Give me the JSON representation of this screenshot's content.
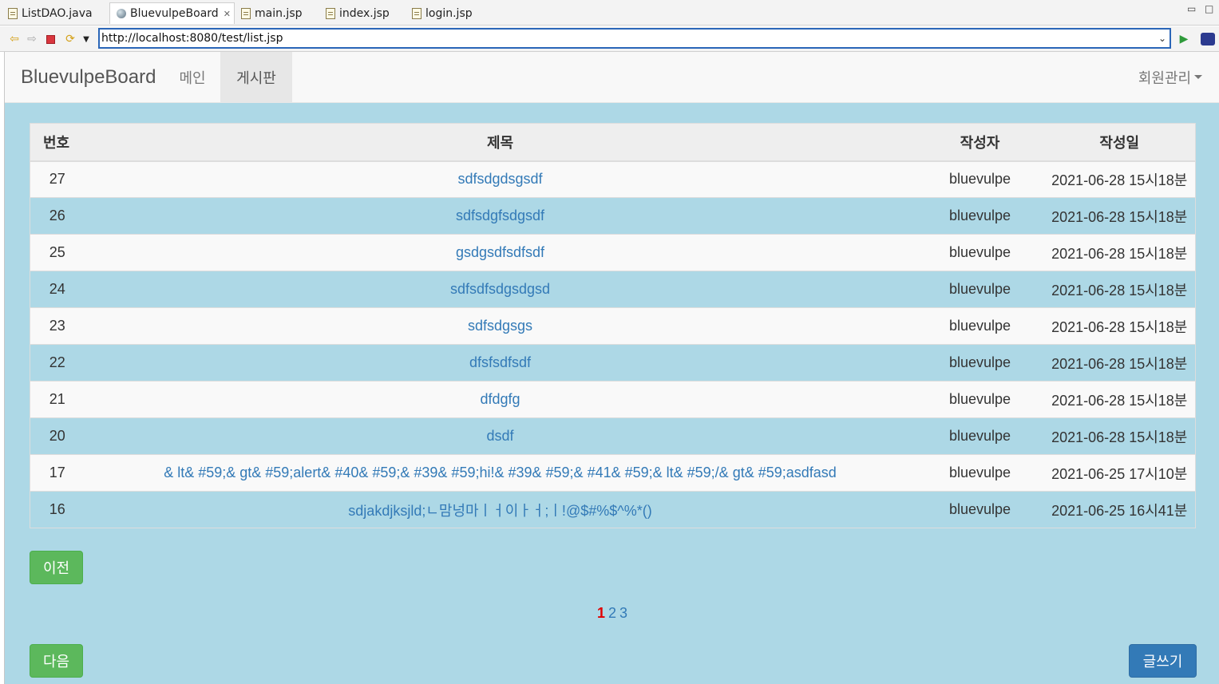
{
  "editor_tabs": [
    {
      "label": "ListDAO.java",
      "icon": "java-file-icon",
      "active": false
    },
    {
      "label": "BluevulpeBoard",
      "icon": "globe-icon",
      "active": true
    },
    {
      "label": "main.jsp",
      "icon": "jsp-file-icon",
      "active": false
    },
    {
      "label": "index.jsp",
      "icon": "jsp-file-icon",
      "active": false
    },
    {
      "label": "login.jsp",
      "icon": "jsp-file-icon",
      "active": false
    }
  ],
  "toolbar": {
    "url": "http://localhost:8080/test/list.jsp",
    "icons": [
      "back-icon",
      "forward-icon",
      "stop-icon",
      "refresh-icon",
      "menu-dropdown-icon",
      "go-icon",
      "eclipse-icon"
    ]
  },
  "navbar": {
    "brand": "BluevulpeBoard",
    "links": [
      "메인",
      "게시판"
    ],
    "active": "게시판",
    "member_menu": "회원관리"
  },
  "table": {
    "headers": {
      "no": "번호",
      "title": "제목",
      "author": "작성자",
      "date": "작성일"
    },
    "rows": [
      {
        "no": "27",
        "title": "sdfsdgdsgsdf",
        "author": "bluevulpe",
        "date": "2021-06-28 15시18분"
      },
      {
        "no": "26",
        "title": "sdfsdgfsdgsdf",
        "author": "bluevulpe",
        "date": "2021-06-28 15시18분"
      },
      {
        "no": "25",
        "title": "gsdgsdfsdfsdf",
        "author": "bluevulpe",
        "date": "2021-06-28 15시18분"
      },
      {
        "no": "24",
        "title": "sdfsdfsdgsdgsd",
        "author": "bluevulpe",
        "date": "2021-06-28 15시18분"
      },
      {
        "no": "23",
        "title": "sdfsdgsgs",
        "author": "bluevulpe",
        "date": "2021-06-28 15시18분"
      },
      {
        "no": "22",
        "title": "dfsfsdfsdf",
        "author": "bluevulpe",
        "date": "2021-06-28 15시18분"
      },
      {
        "no": "21",
        "title": "dfdgfg",
        "author": "bluevulpe",
        "date": "2021-06-28 15시18분"
      },
      {
        "no": "20",
        "title": "dsdf",
        "author": "bluevulpe",
        "date": "2021-06-28 15시18분"
      },
      {
        "no": "17",
        "title": "& lt& #59;& gt& #59;alert& #40& #59;& #39& #59;hi!& #39& #59;& #41& #59;& lt& #59;/& gt& #59;asdfasd",
        "author": "bluevulpe",
        "date": "2021-06-25 17시10분"
      },
      {
        "no": "16",
        "title": "sdjakdjksjld;ㄴ맘넝마ㅣㅓ이ㅏㅓ;ㅣ!@$#%$^%*()",
        "author": "bluevulpe",
        "date": "2021-06-25 16시41분"
      }
    ]
  },
  "buttons": {
    "prev": "이전",
    "next": "다음",
    "write": "글쓰기"
  },
  "pagination": {
    "current": "1",
    "pages": [
      "2",
      "3"
    ]
  },
  "colors": {
    "page_bg": "#add8e6",
    "link": "#337ab7",
    "current_page": "#e00000",
    "green_button": "#5cb85c",
    "blue_button": "#337ab7"
  }
}
